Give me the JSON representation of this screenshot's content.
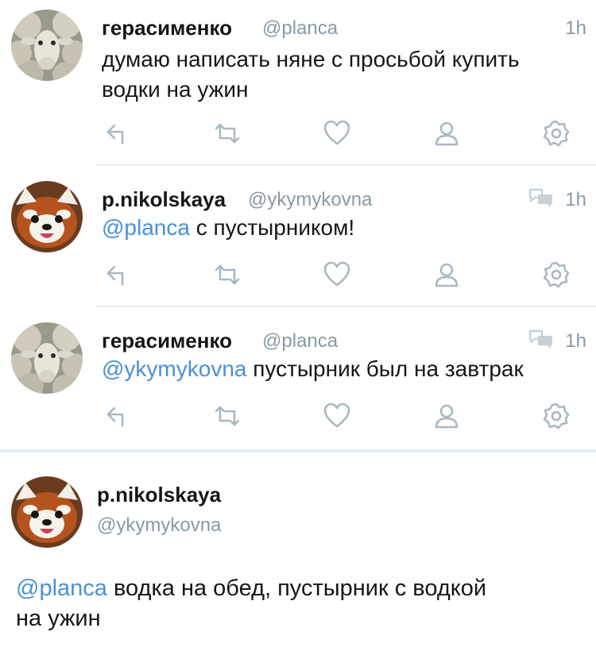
{
  "colors": {
    "name": "#14171a",
    "secondary": "#8899a6",
    "mention": "#4a90d9",
    "icon": "#aab8c2",
    "divider": "#e6ecf0"
  },
  "tweets": [
    {
      "name": "герасименко",
      "handle": "@planca",
      "time": "1h",
      "conversation_icon": false,
      "avatar": "sheep-avatar",
      "mention": "",
      "text": "думаю написать няне с просьбой купить водки на ужин"
    },
    {
      "name": "p.nikolskaya",
      "handle": "@ykymykovna",
      "time": "1h",
      "conversation_icon": true,
      "avatar": "red-panda-avatar",
      "mention": "@planca",
      "text": " с пустырником!"
    },
    {
      "name": "герасименко",
      "handle": "@planca",
      "time": "1h",
      "conversation_icon": true,
      "avatar": "sheep-avatar",
      "mention": "@ykymykovna",
      "text": " пустырник был на завтрак"
    }
  ],
  "actions": [
    "reply-icon",
    "retweet-icon",
    "like-icon",
    "follow-icon",
    "settings-icon"
  ],
  "focused_tweet": {
    "name": "p.nikolskaya",
    "handle": "@ykymykovna",
    "avatar": "red-panda-avatar",
    "mention": "@planca",
    "text": " водка на обед, пустырник с водкой",
    "text_line2": "на ужин"
  }
}
